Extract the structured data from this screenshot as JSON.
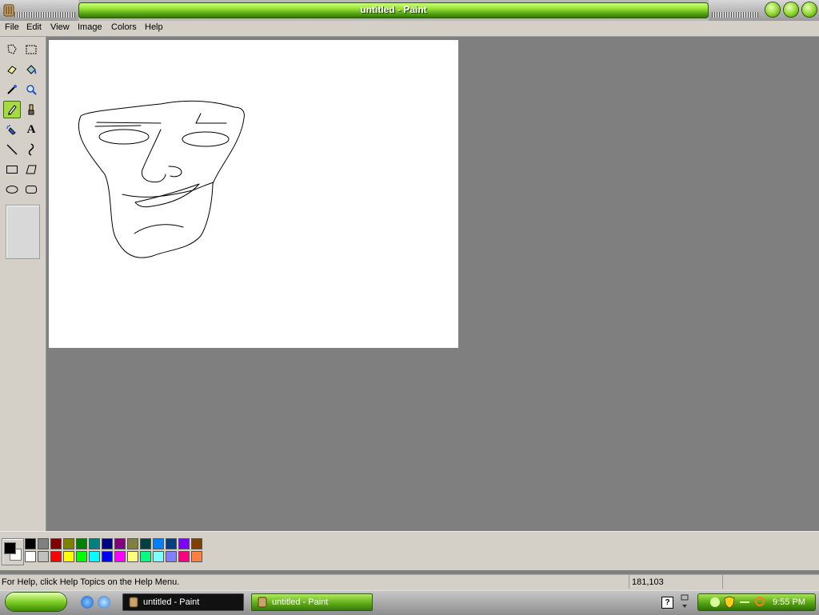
{
  "window": {
    "title": "untitled - Paint"
  },
  "menu": {
    "items": [
      "File",
      "Edit",
      "View",
      "Image",
      "Colors",
      "Help"
    ]
  },
  "toolbox": {
    "tools": [
      {
        "icon": "free-form-select-icon"
      },
      {
        "icon": "rectangle-select-icon"
      },
      {
        "icon": "eraser-icon"
      },
      {
        "icon": "fill-bucket-icon"
      },
      {
        "icon": "color-picker-icon"
      },
      {
        "icon": "magnifier-icon"
      },
      {
        "icon": "pencil-icon",
        "selected": true
      },
      {
        "icon": "brush-icon"
      },
      {
        "icon": "airbrush-icon"
      },
      {
        "icon": "text-icon",
        "glyph": "A"
      },
      {
        "icon": "line-icon"
      },
      {
        "icon": "curve-icon"
      },
      {
        "icon": "rectangle-icon"
      },
      {
        "icon": "polygon-icon"
      },
      {
        "icon": "ellipse-icon"
      },
      {
        "icon": "rounded-rectangle-icon"
      }
    ]
  },
  "palette": {
    "foreground": "#000000",
    "background": "#ffffff",
    "top_row": [
      "#000000",
      "#808080",
      "#800000",
      "#808000",
      "#008000",
      "#008080",
      "#000080",
      "#800080",
      "#808040",
      "#004040",
      "#0080ff",
      "#004080",
      "#8000ff",
      "#804000"
    ],
    "bottom_row": [
      "#ffffff",
      "#c0c0c0",
      "#ff0000",
      "#ffff00",
      "#00ff00",
      "#00ffff",
      "#0000ff",
      "#ff00ff",
      "#ffff80",
      "#00ff80",
      "#80ffff",
      "#8080ff",
      "#ff0080",
      "#ff8040"
    ]
  },
  "status": {
    "help_text": "For Help, click Help Topics on the Help Menu.",
    "coordinates": "181,103"
  },
  "taskbar": {
    "tasks": [
      "untitled - Paint",
      "untitled - Paint"
    ],
    "clock": "9:55 PM"
  },
  "colors": {
    "title_green": "#6cc21c",
    "selected_tool": "#a6da43",
    "workspace": "#7f7f7f",
    "chrome": "#d4d0c8"
  }
}
